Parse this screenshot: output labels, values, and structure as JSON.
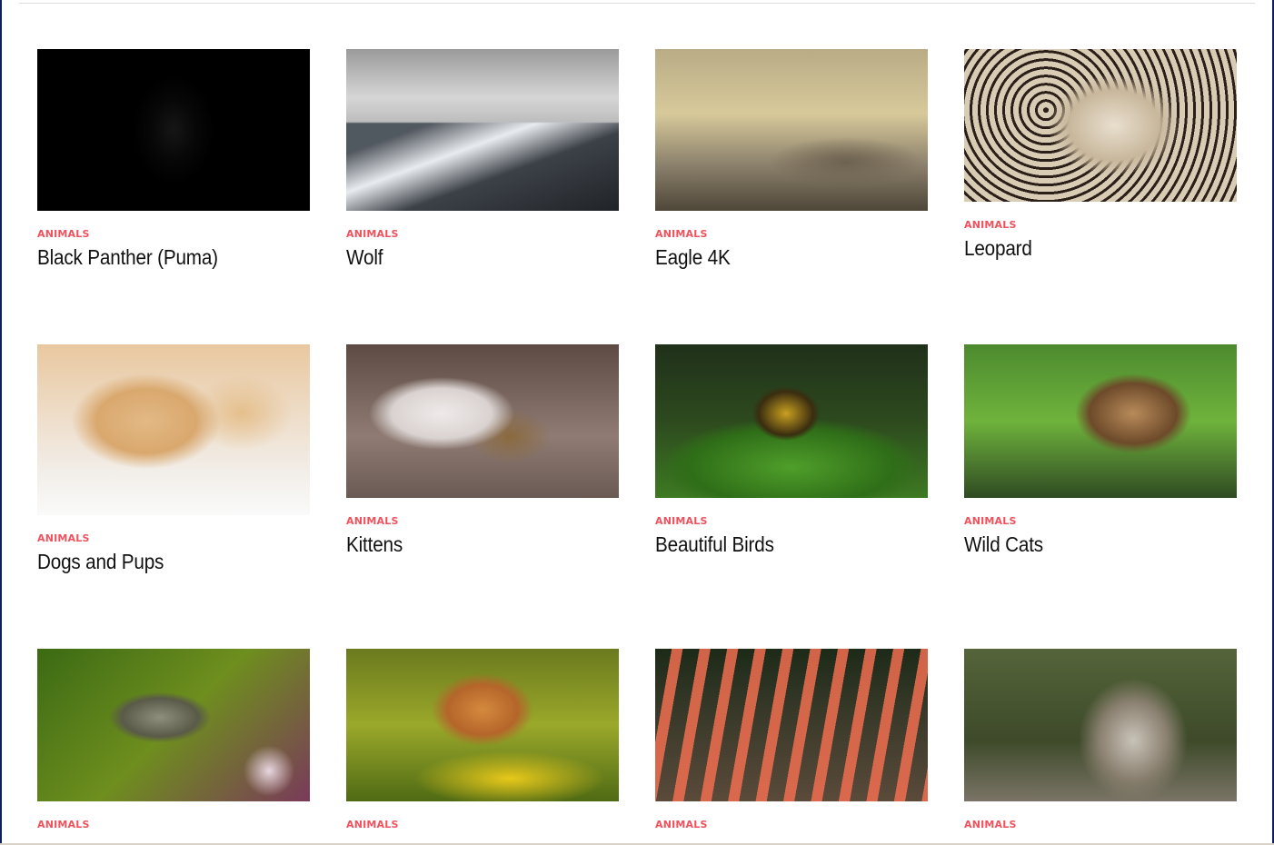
{
  "category_label": "ANIMALS",
  "colors": {
    "category": "#f0525d",
    "title": "#111111",
    "frame": "#0d1f5c"
  },
  "cards": [
    {
      "category": "ANIMALS",
      "title": "Black Panther (Puma)",
      "image": "black-panther-image"
    },
    {
      "category": "ANIMALS",
      "title": "Wolf",
      "image": "wolf-mountain-image"
    },
    {
      "category": "ANIMALS",
      "title": "Eagle 4K",
      "image": "eagle-image"
    },
    {
      "category": "ANIMALS",
      "title": "Leopard",
      "image": "leopard-image"
    },
    {
      "category": "ANIMALS",
      "title": "Dogs and Pups",
      "image": "puppies-image"
    },
    {
      "category": "ANIMALS",
      "title": "Kittens",
      "image": "kitten-image"
    },
    {
      "category": "ANIMALS",
      "title": "Beautiful Birds",
      "image": "birds-image"
    },
    {
      "category": "ANIMALS",
      "title": "Wild Cats",
      "image": "wild-cat-image"
    },
    {
      "category": "ANIMALS",
      "title": "",
      "image": "hummingbird-image"
    },
    {
      "category": "ANIMALS",
      "title": "",
      "image": "shiba-image"
    },
    {
      "category": "ANIMALS",
      "title": "",
      "image": "flamingos-image"
    },
    {
      "category": "ANIMALS",
      "title": "",
      "image": "gray-wolf-image"
    }
  ]
}
